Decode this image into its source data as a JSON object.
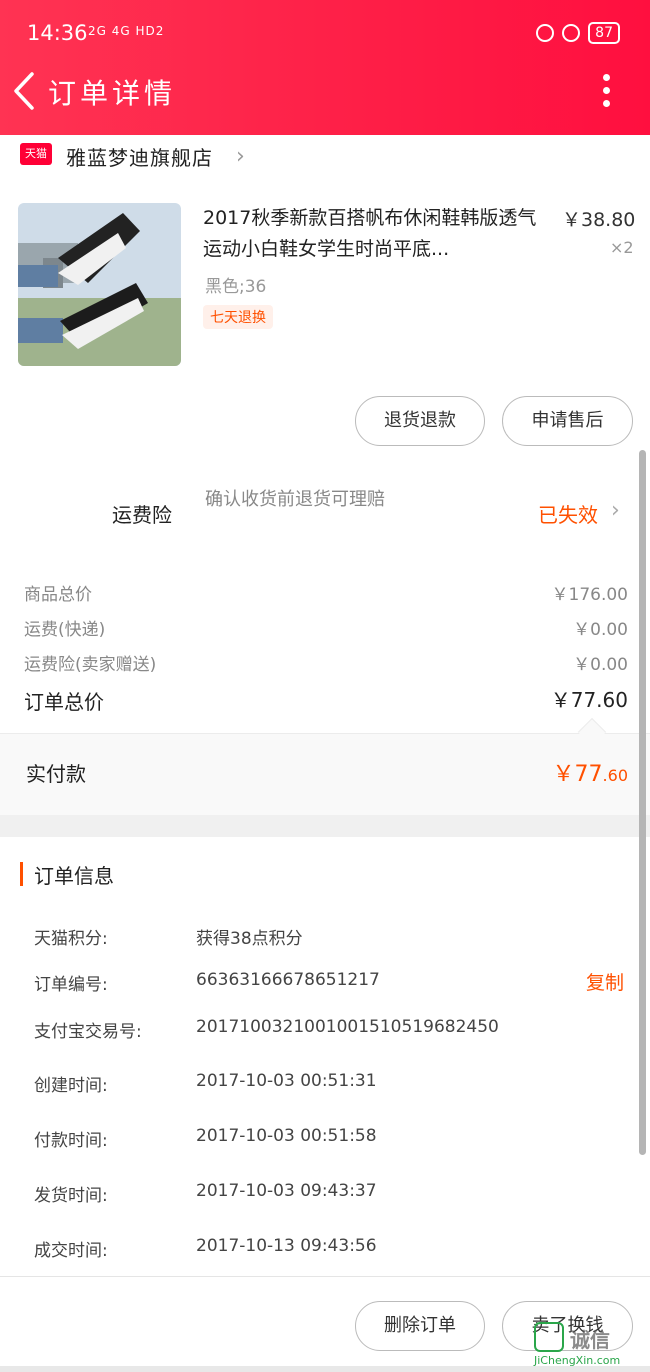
{
  "status_bar": {
    "time": "14:36",
    "signal": "2G 4G HD2",
    "battery": "87"
  },
  "header": {
    "title": "订单详情"
  },
  "shop": {
    "badge": "天猫",
    "name": "雅蓝梦迪旗舰店"
  },
  "product": {
    "title": "2017秋季新款百搭帆布休闲鞋韩版透气运动小白鞋女学生时尚平底...",
    "price": "￥38.80",
    "quantity": "×2",
    "sku": "黑色;36",
    "tag": "七天退换"
  },
  "item_actions": {
    "refund_label": "退货退款",
    "after_sale_label": "申请售后"
  },
  "insurance": {
    "label": "运费险",
    "description": "确认收货前退货可理赔",
    "status": "已失效"
  },
  "fees": [
    {
      "label": "商品总价",
      "value": "￥176.00"
    },
    {
      "label": "运费(快递)",
      "value": "￥0.00"
    },
    {
      "label": "运费险(卖家赠送)",
      "value": "￥0.00"
    }
  ],
  "order_total": {
    "label": "订单总价",
    "value": "￥77.60"
  },
  "paid": {
    "label": "实付款",
    "currency": "￥",
    "integer": "77",
    "decimal": ".60"
  },
  "order_info": {
    "title": "订单信息",
    "copy_label": "复制",
    "rows": [
      {
        "label": "天猫积分:",
        "value": "获得38点积分"
      },
      {
        "label": "订单编号:",
        "value": "66363166678651217"
      },
      {
        "label": "支付宝交易号:",
        "value": "2017100321001001510519682450"
      },
      {
        "label": "创建时间:",
        "value": "2017-10-03 00:51:31"
      },
      {
        "label": "付款时间:",
        "value": "2017-10-03 00:51:58"
      },
      {
        "label": "发货时间:",
        "value": "2017-10-03 09:43:37"
      },
      {
        "label": "成交时间:",
        "value": "2017-10-13 09:43:56"
      }
    ]
  },
  "bottom_actions": {
    "delete_label": "删除订单",
    "refund_label": "卖了换钱"
  },
  "watermark": {
    "text": "诚信",
    "url": "JiChengXin.com"
  },
  "colors": {
    "header_red": "#ff1f47",
    "accent_orange": "#ff5000"
  }
}
